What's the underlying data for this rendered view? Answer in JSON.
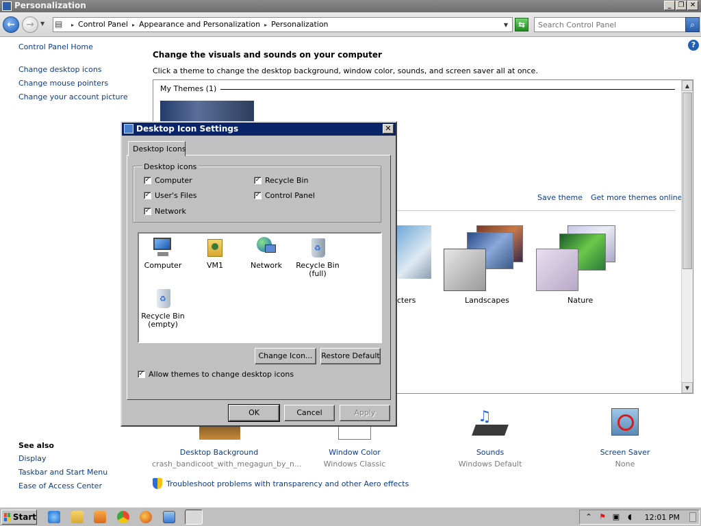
{
  "window": {
    "title": "Personalization"
  },
  "address": {
    "crumbs": [
      "Control Panel",
      "Appearance and Personalization",
      "Personalization"
    ],
    "search_placeholder": "Search Control Panel"
  },
  "leftnav": {
    "home": "Control Panel Home",
    "links": [
      "Change desktop icons",
      "Change mouse pointers",
      "Change your account picture"
    ]
  },
  "main": {
    "title": "Change the visuals and sounds on your computer",
    "subtitle": "Click a theme to change the desktop background, window color, sounds, and screen saver all at once.",
    "my_themes": "My Themes (1)",
    "save_theme": "Save theme",
    "get_more": "Get more themes online",
    "themes": [
      "cters",
      "Landscapes",
      "Nature"
    ]
  },
  "bottom": {
    "items": [
      {
        "label": "Desktop Background",
        "sub": "crash_bandicoot_with_megagun_by_n..."
      },
      {
        "label": "Window Color",
        "sub": "Windows Classic"
      },
      {
        "label": "Sounds",
        "sub": "Windows Default"
      },
      {
        "label": "Screen Saver",
        "sub": "None"
      }
    ],
    "troubleshoot": "Troubleshoot problems with transparency and other Aero effects"
  },
  "seealso": {
    "title": "See also",
    "links": [
      "Display",
      "Taskbar and Start Menu",
      "Ease of Access Center"
    ]
  },
  "dialog": {
    "title": "Desktop Icon Settings",
    "tab": "Desktop Icons",
    "group_label": "Desktop icons",
    "checkboxes": [
      {
        "label": "Computer",
        "checked": true
      },
      {
        "label": "Recycle Bin",
        "checked": true
      },
      {
        "label": "User's Files",
        "checked": true
      },
      {
        "label": "Control Panel",
        "checked": true
      },
      {
        "label": "Network",
        "checked": true
      }
    ],
    "icons": [
      {
        "label": "Computer",
        "icon": "computer-icon"
      },
      {
        "label": "VM1",
        "icon": "user-folder-icon"
      },
      {
        "label": "Network",
        "icon": "network-icon"
      },
      {
        "label": "Recycle Bin (full)",
        "icon": "recycle-bin-full-icon"
      },
      {
        "label": "Recycle Bin (empty)",
        "icon": "recycle-bin-empty-icon"
      }
    ],
    "change_icon": "Change Icon...",
    "restore_default": "Restore Default",
    "allow_themes": "Allow themes to change desktop icons",
    "ok": "OK",
    "cancel": "Cancel",
    "apply": "Apply"
  },
  "taskbar": {
    "start": "Start",
    "clock": "12:01 PM"
  }
}
